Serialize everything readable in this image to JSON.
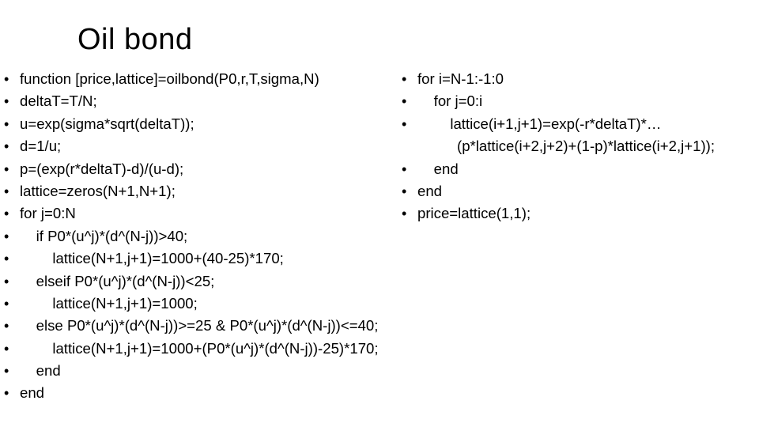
{
  "title": "Oil bond",
  "bullet_glyph": "•",
  "left_column": [
    "function [price,lattice]=oilbond(P0,r,T,sigma,N)",
    "deltaT=T/N;",
    "u=exp(sigma*sqrt(deltaT));",
    "d=1/u;",
    "p=(exp(r*deltaT)-d)/(u-d);",
    "lattice=zeros(N+1,N+1);",
    "for j=0:N",
    "    if P0*(u^j)*(d^(N-j))>40;",
    "        lattice(N+1,j+1)=1000+(40-25)*170;",
    "    elseif P0*(u^j)*(d^(N-j))<25;",
    "        lattice(N+1,j+1)=1000;",
    "    else P0*(u^j)*(d^(N-j))>=25 & P0*(u^j)*(d^(N-j))<=40;",
    "        lattice(N+1,j+1)=1000+(P0*(u^j)*(d^(N-j))-25)*170;",
    "    end",
    "end"
  ],
  "right_column": {
    "line0": "for i=N-1:-1:0",
    "line1": "    for j=0:i",
    "line2": "        lattice(i+1,j+1)=exp(-r*deltaT)*…",
    "line2_cont": "(p*lattice(i+2,j+2)+(1-p)*lattice(i+2,j+1));",
    "line3": "    end",
    "line4": "end",
    "line5": "price=lattice(1,1);"
  }
}
